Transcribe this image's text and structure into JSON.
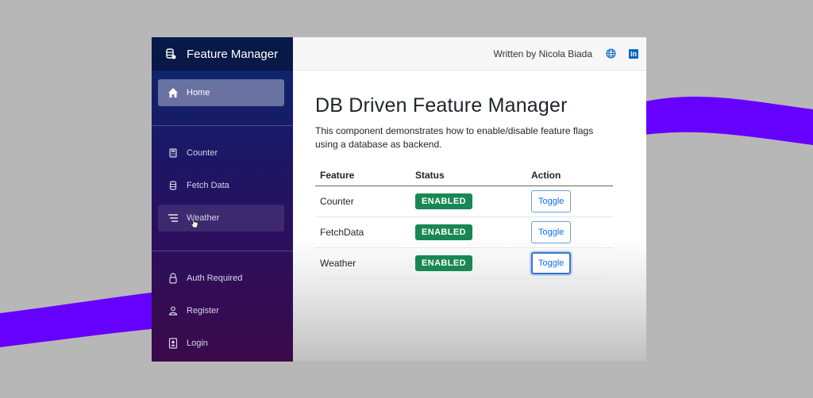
{
  "app": {
    "brand": "Feature Manager",
    "topbar": {
      "author": "Written by Nicola Biada",
      "icons": [
        "globe-icon",
        "linkedin-icon"
      ],
      "linkedin_glyph": "in"
    }
  },
  "sidebar": {
    "items": [
      {
        "label": "Home",
        "icon": "home-icon",
        "state": "active"
      },
      {
        "label": "Counter",
        "icon": "calculator-icon",
        "state": "default"
      },
      {
        "label": "Fetch Data",
        "icon": "database-icon",
        "state": "default"
      },
      {
        "label": "Weather",
        "icon": "list-icon",
        "state": "hover"
      },
      {
        "label": "Auth Required",
        "icon": "lock-icon",
        "state": "default"
      },
      {
        "label": "Register",
        "icon": "person-icon",
        "state": "default"
      },
      {
        "label": "Login",
        "icon": "id-badge-icon",
        "state": "default"
      }
    ]
  },
  "main": {
    "title": "DB Driven Feature Manager",
    "description": "This component demonstrates how to enable/disable feature flags using a database as backend.",
    "table": {
      "headers": [
        "Feature",
        "Status",
        "Action"
      ],
      "rows": [
        {
          "feature": "Counter",
          "status": "ENABLED",
          "action": "Toggle"
        },
        {
          "feature": "FetchData",
          "status": "ENABLED",
          "action": "Toggle"
        },
        {
          "feature": "Weather",
          "status": "ENABLED",
          "action": "Toggle",
          "focused": true
        }
      ]
    }
  },
  "colors": {
    "accent_wave": "#6600ff",
    "badge_enabled": "#198754",
    "toggle_text": "#0d6efd",
    "background": "#b7b7b7"
  }
}
